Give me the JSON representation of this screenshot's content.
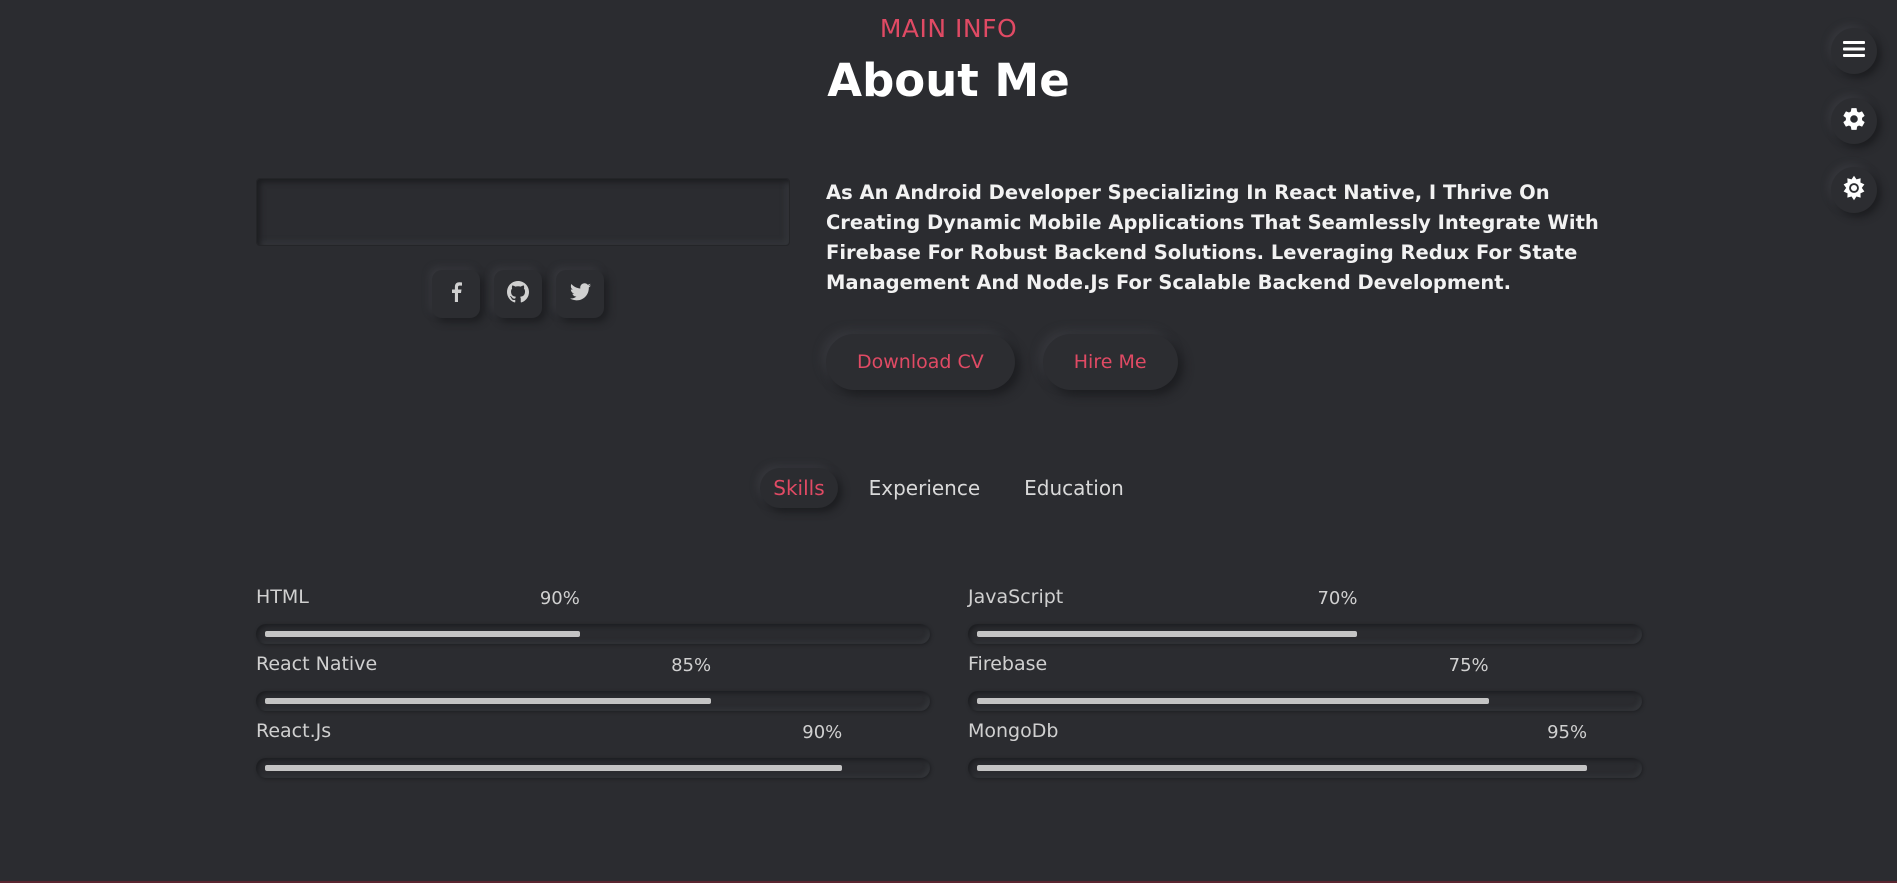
{
  "header": {
    "eyebrow": "MAIN INFO",
    "title": "About Me"
  },
  "social": [
    {
      "icon": "facebook-icon"
    },
    {
      "icon": "github-icon"
    },
    {
      "icon": "twitter-icon"
    }
  ],
  "about": {
    "text": "As An Android Developer Specializing In React Native, I Thrive On Creating Dynamic Mobile Applications That Seamlessly Integrate With Firebase For Robust Backend Solutions. Leveraging Redux For State Management And Node.Js For Scalable Backend Development.",
    "download_label": "Download CV",
    "hire_label": "Hire Me"
  },
  "tabs": [
    {
      "label": "Skills",
      "active": true
    },
    {
      "label": "Experience",
      "active": false
    },
    {
      "label": "Education",
      "active": false
    }
  ],
  "skills": [
    {
      "name": "HTML",
      "percent_label": "90%",
      "fill_fraction": 0.48,
      "label_fraction": 0.4
    },
    {
      "name": "JavaScript",
      "percent_label": "70%",
      "fill_fraction": 0.58,
      "label_fraction": 0.49
    },
    {
      "name": "React Native",
      "percent_label": "85%",
      "fill_fraction": 0.68,
      "label_fraction": 0.57
    },
    {
      "name": "Firebase",
      "percent_label": "75%",
      "fill_fraction": 0.78,
      "label_fraction": 0.66
    },
    {
      "name": "React.Js",
      "percent_label": "90%",
      "fill_fraction": 0.88,
      "label_fraction": 0.74
    },
    {
      "name": "MongoDb",
      "percent_label": "95%",
      "fill_fraction": 0.93,
      "label_fraction": 0.79
    }
  ],
  "sidebar": [
    {
      "icon": "menu-icon"
    },
    {
      "icon": "gear-icon"
    },
    {
      "icon": "sun-icon"
    }
  ],
  "colors": {
    "accent": "#e04a64",
    "background": "#2b2c30"
  }
}
